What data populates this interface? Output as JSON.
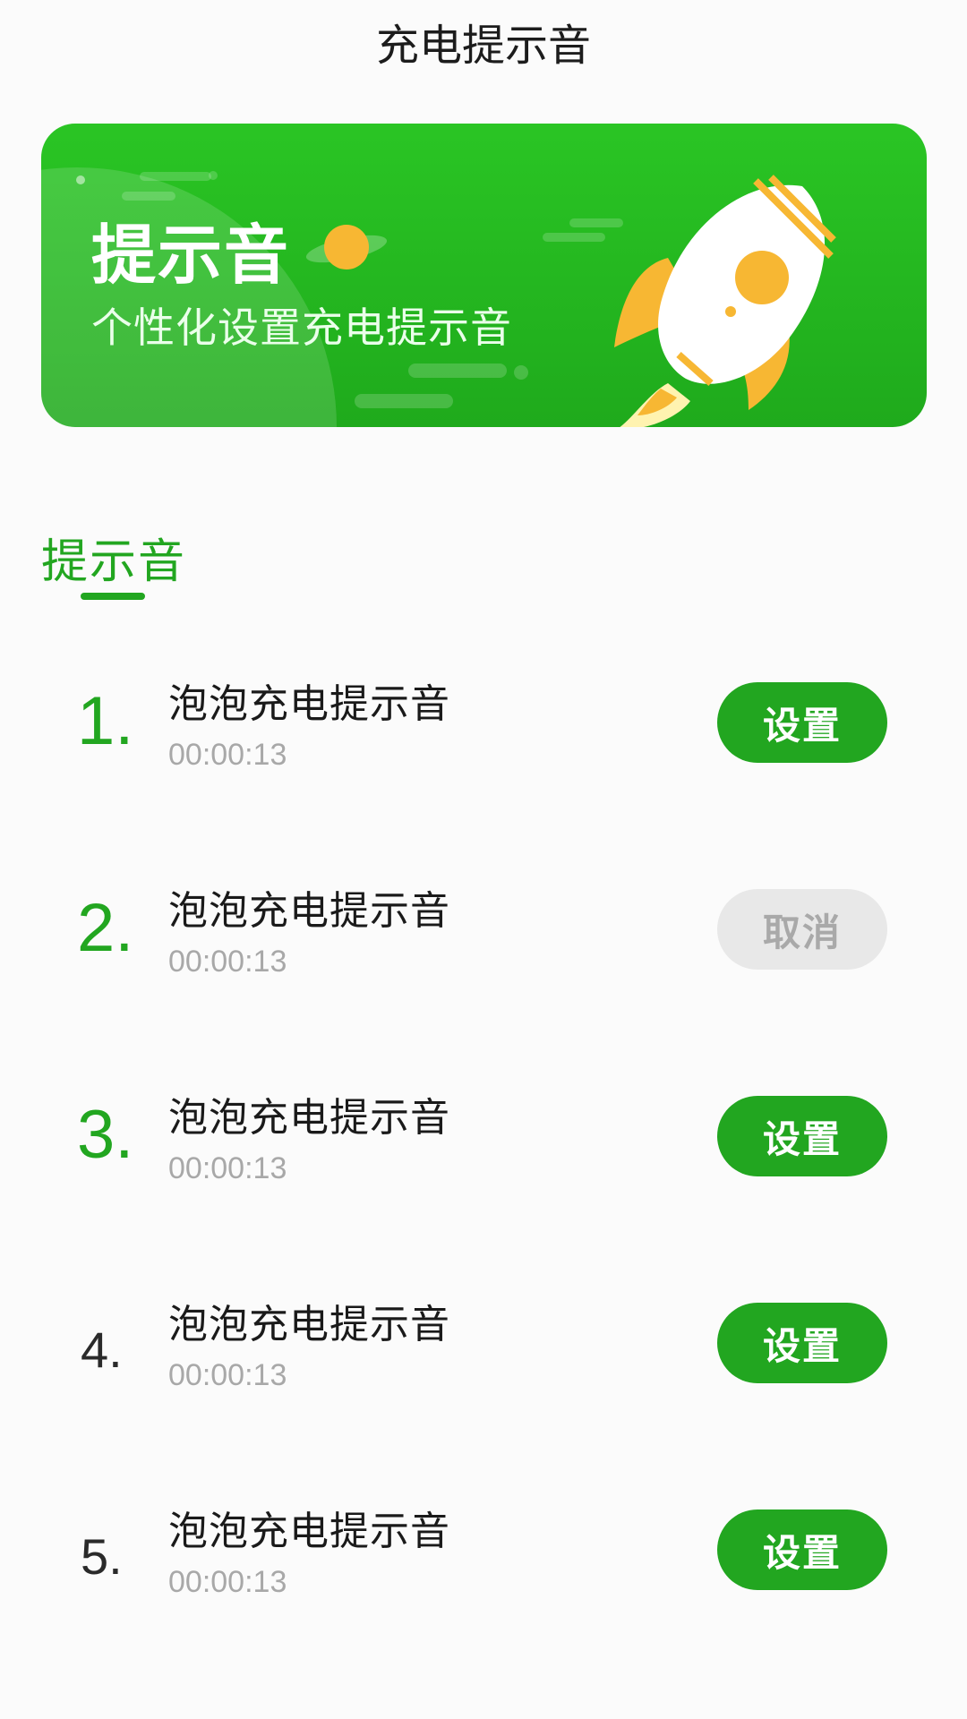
{
  "header": {
    "title": "充电提示音"
  },
  "banner": {
    "title": "提示音",
    "subtitle": "个性化设置充电提示音",
    "illustration_icon": "rocket-icon",
    "colors": {
      "gradient_top": "#2ac524",
      "gradient_bottom": "#1faa1c",
      "accent": "#f7b733"
    }
  },
  "section": {
    "title": "提示音"
  },
  "items": [
    {
      "number": "1.",
      "name": "泡泡充电提示音",
      "duration": "00:00:13",
      "action": "设置",
      "state": "primary"
    },
    {
      "number": "2.",
      "name": "泡泡充电提示音",
      "duration": "00:00:13",
      "action": "取消",
      "state": "secondary"
    },
    {
      "number": "3.",
      "name": "泡泡充电提示音",
      "duration": "00:00:13",
      "action": "设置",
      "state": "primary"
    },
    {
      "number": "4.",
      "name": "泡泡充电提示音",
      "duration": "00:00:13",
      "action": "设置",
      "state": "primary"
    },
    {
      "number": "5.",
      "name": "泡泡充电提示音",
      "duration": "00:00:13",
      "action": "设置",
      "state": "primary"
    }
  ],
  "colors": {
    "primary": "#22a620",
    "muted_button": "#e8e8e8",
    "muted_text": "#a8a8a8"
  }
}
